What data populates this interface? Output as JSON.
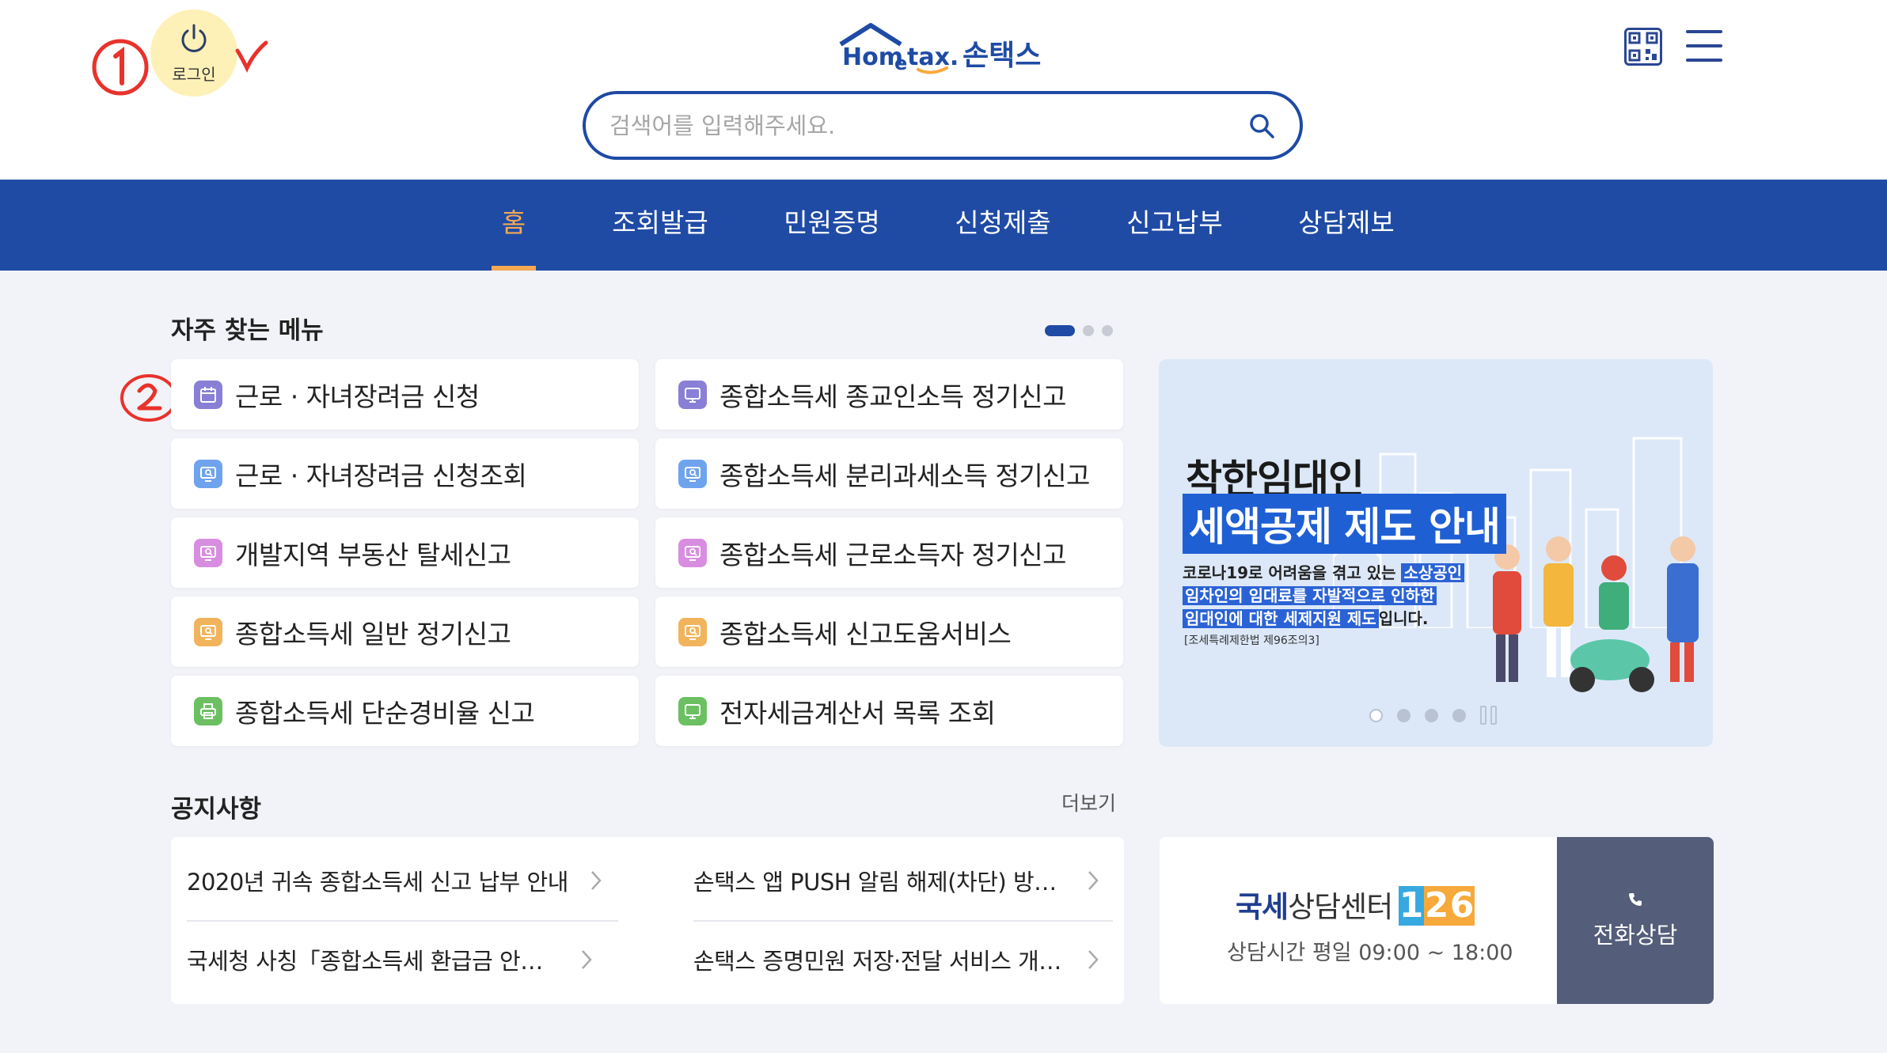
{
  "header": {
    "login_label": "로그인",
    "logo_text": "Hometax",
    "logo_korean": "손택스",
    "search_placeholder": "검색어를 입력해주세요."
  },
  "annotations": {
    "mark1": "①",
    "mark2": "②"
  },
  "nav": {
    "items": [
      {
        "label": "홈",
        "active": true
      },
      {
        "label": "조회발급"
      },
      {
        "label": "민원증명"
      },
      {
        "label": "신청제출"
      },
      {
        "label": "신고납부"
      },
      {
        "label": "상담제보"
      }
    ]
  },
  "frequent": {
    "title": "자주 찾는 메뉴",
    "left": [
      {
        "label": "근로 · 자녀장려금 신청",
        "icon": "calendar-icon",
        "color": "#8a7fd6"
      },
      {
        "label": "근로 · 자녀장려금 신청조회",
        "icon": "monitor-search-icon",
        "color": "#6fa3ee"
      },
      {
        "label": "개발지역 부동산 탈세신고",
        "icon": "monitor-search-icon",
        "color": "#d88ee0"
      },
      {
        "label": "종합소득세 일반 정기신고",
        "icon": "monitor-search-icon",
        "color": "#f1b45c"
      },
      {
        "label": "종합소득세 단순경비율 신고",
        "icon": "printer-icon",
        "color": "#6cc062"
      }
    ],
    "right": [
      {
        "label": "종합소득세 종교인소득 정기신고",
        "icon": "monitor-icon",
        "color": "#8a7fd6"
      },
      {
        "label": "종합소득세 분리과세소득 정기신고",
        "icon": "monitor-search-icon",
        "color": "#6fa3ee"
      },
      {
        "label": "종합소득세 근로소득자 정기신고",
        "icon": "monitor-search-icon",
        "color": "#d88ee0"
      },
      {
        "label": "종합소득세 신고도움서비스",
        "icon": "monitor-search-icon",
        "color": "#f1b45c"
      },
      {
        "label": "전자세금계산서 목록 조회",
        "icon": "monitor-icon",
        "color": "#6cc062"
      }
    ]
  },
  "banner": {
    "title1": "착한임대인",
    "title2": "세액공제 제도 안내",
    "desc_plain1": "코로나19로 어려움을 겪고 있는 ",
    "desc_hl1": "소상공인",
    "desc_hl2": "임차인의 임대료를 자발적으로 인하한",
    "desc_hl3": "임대인에 대한 세제지원 제도",
    "desc_plain2": "입니다.",
    "law": "[조세특례제한법 제96조의3]"
  },
  "notices": {
    "title": "공지사항",
    "more": "더보기",
    "items": [
      "2020년 귀속 종합소득세 신고 납부 안내",
      "손택스 앱 PUSH 알림 해제(차단) 방법 …",
      "국세청 사칭「종합소득세 환급금 안내」…",
      "손택스 증명민원 저장·전달 서비스 개시…"
    ]
  },
  "consult": {
    "title_bold": "국세",
    "title_thin": "상담센터",
    "number_digits": [
      "1",
      "2",
      "6"
    ],
    "number_colors": [
      "#38a9e0",
      "#f7a93b",
      "#f7a93b"
    ],
    "hours": "상담시간 평일 09:00 ~ 18:00",
    "call_label": "전화상담"
  },
  "colors": {
    "brand_blue": "#1f4ba5",
    "nav_active": "#f4a953",
    "call_button": "#545d7a"
  }
}
